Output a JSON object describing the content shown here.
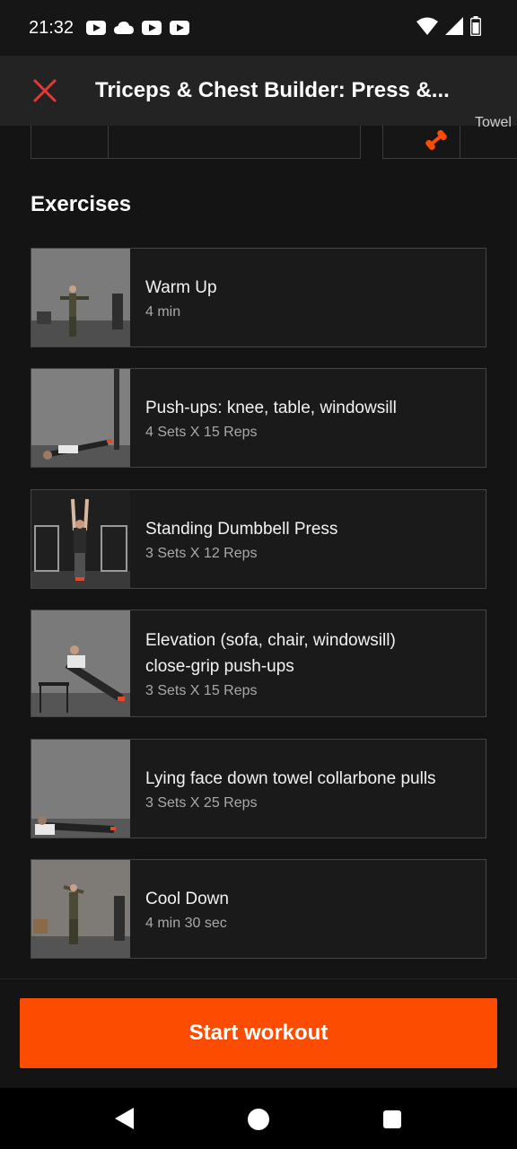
{
  "status_bar": {
    "time": "21:32",
    "icons": [
      "youtube-icon",
      "cloud-icon",
      "youtube-icon",
      "youtube-icon",
      "wifi-icon",
      "signal-icon",
      "battery-icon"
    ]
  },
  "header": {
    "title": "Triceps & Chest Builder: Press &...",
    "close_icon": "close-icon",
    "accent_color": "#e53935"
  },
  "equipment_partial": {
    "text": "Towel",
    "icon": "dumbbell-icon"
  },
  "section": {
    "title": "Exercises"
  },
  "exercises": [
    {
      "name": "Warm Up",
      "detail": "4 min"
    },
    {
      "name": "Push-ups: knee, table, windowsill",
      "detail": "4 Sets X 15 Reps"
    },
    {
      "name": "Standing Dumbbell Press",
      "detail": "3 Sets X 12 Reps"
    },
    {
      "name": "Elevation (sofa, chair, windowsill) close-grip push-ups",
      "detail": "3 Sets X 15 Reps"
    },
    {
      "name": "Lying face down towel collarbone pulls",
      "detail": "3 Sets X 25 Reps"
    },
    {
      "name": "Cool Down",
      "detail": "4 min 30 sec"
    }
  ],
  "start_button": {
    "label": "Start workout",
    "color": "#fc4c02"
  },
  "nav": {
    "icons": [
      "back-icon",
      "home-icon",
      "recents-icon"
    ]
  }
}
